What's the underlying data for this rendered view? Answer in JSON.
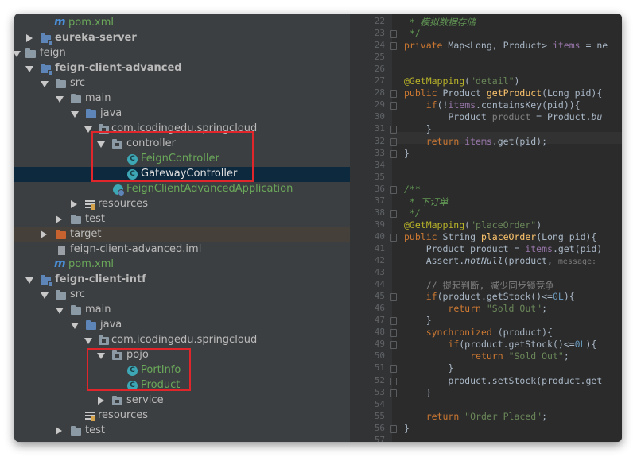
{
  "tree": {
    "rows": [
      {
        "label": "pom.xml"
      },
      {
        "label": "eureka-server"
      },
      {
        "label": "feign"
      },
      {
        "label": "feign-client-advanced"
      },
      {
        "label": "src"
      },
      {
        "label": "main"
      },
      {
        "label": "java"
      },
      {
        "label": "com.icodingedu.springcloud"
      },
      {
        "label": "controller"
      },
      {
        "label": "FeignController"
      },
      {
        "label": "GatewayController"
      },
      {
        "label": "FeignClientAdvancedApplication"
      },
      {
        "label": "resources"
      },
      {
        "label": "test"
      },
      {
        "label": "target"
      },
      {
        "label": "feign-client-advanced.iml"
      },
      {
        "label": "pom.xml"
      },
      {
        "label": "feign-client-intf"
      },
      {
        "label": "src"
      },
      {
        "label": "main"
      },
      {
        "label": "java"
      },
      {
        "label": "com.icodingedu.springcloud"
      },
      {
        "label": "pojo"
      },
      {
        "label": "PortInfo"
      },
      {
        "label": "Product"
      },
      {
        "label": "service"
      },
      {
        "label": "resources"
      },
      {
        "label": "test"
      }
    ]
  },
  "editor": {
    "line_numbers": [
      "22",
      "23",
      "24",
      "25",
      "26",
      "27",
      "28",
      "29",
      "30",
      "31",
      "32",
      "33",
      "34",
      "35",
      "36",
      "37",
      "38",
      "39",
      "40",
      "41",
      "42",
      "43",
      "44",
      "45",
      "46",
      "47",
      "48",
      "49",
      "50",
      "51",
      "52",
      "53",
      "54",
      "55",
      "56",
      "57"
    ],
    "lines": [
      [
        {
          "t": "com",
          "v": " * 模拟数据存储"
        }
      ],
      [
        {
          "t": "com",
          "v": " */"
        }
      ],
      [
        {
          "t": "kw",
          "v": "private "
        },
        {
          "t": "txt",
          "v": "Map<Long, Product> "
        },
        {
          "t": "fld",
          "v": "items"
        },
        {
          "t": "txt",
          "v": " = ne"
        }
      ],
      [],
      [],
      [
        {
          "t": "ann",
          "v": "@GetMapping"
        },
        {
          "t": "txt",
          "v": "("
        },
        {
          "t": "str",
          "v": "\"detail\""
        },
        {
          "t": "txt",
          "v": ")"
        }
      ],
      [
        {
          "t": "kw",
          "v": "public "
        },
        {
          "t": "txt",
          "v": "Product "
        },
        {
          "t": "fn",
          "v": "getProduct"
        },
        {
          "t": "txt",
          "v": "(Long pid){"
        }
      ],
      [
        {
          "t": "txt",
          "v": "    "
        },
        {
          "t": "kw",
          "v": "if"
        },
        {
          "t": "txt",
          "v": "(!"
        },
        {
          "t": "fld",
          "v": "items"
        },
        {
          "t": "txt",
          "v": ".containsKey(pid)){"
        }
      ],
      [
        {
          "t": "txt",
          "v": "        Product "
        },
        {
          "t": "gray",
          "v": "product"
        },
        {
          "t": "txt",
          "v": " = Product."
        },
        {
          "t": "ital",
          "v": "bu"
        }
      ],
      [
        {
          "t": "txt",
          "v": "    }"
        }
      ],
      [
        {
          "t": "txt",
          "v": "    "
        },
        {
          "t": "kw",
          "v": "return "
        },
        {
          "t": "fld",
          "v": "items"
        },
        {
          "t": "txt",
          "v": ".get(pid);"
        }
      ],
      [
        {
          "t": "txt",
          "v": "}"
        }
      ],
      [],
      [],
      [
        {
          "t": "com",
          "v": "/**"
        }
      ],
      [
        {
          "t": "com",
          "v": " * 下订单"
        }
      ],
      [
        {
          "t": "com",
          "v": " */"
        }
      ],
      [
        {
          "t": "ann",
          "v": "@GetMapping"
        },
        {
          "t": "txt",
          "v": "("
        },
        {
          "t": "str",
          "v": "\"placeOrder\""
        },
        {
          "t": "txt",
          "v": ")"
        }
      ],
      [
        {
          "t": "kw",
          "v": "public "
        },
        {
          "t": "txt",
          "v": "String "
        },
        {
          "t": "fn",
          "v": "placeOrder"
        },
        {
          "t": "txt",
          "v": "(Long pid){"
        }
      ],
      [
        {
          "t": "txt",
          "v": "    Product product = "
        },
        {
          "t": "fld",
          "v": "items"
        },
        {
          "t": "txt",
          "v": ".get(pid)"
        }
      ],
      [
        {
          "t": "txt",
          "v": "    Assert."
        },
        {
          "t": "ital",
          "v": "notNull"
        },
        {
          "t": "txt",
          "v": "(product, "
        },
        {
          "t": "hint",
          "v": "message:"
        }
      ],
      [],
      [
        {
          "t": "gray",
          "v": "    // 提起判断, 减少同步锁竞争"
        }
      ],
      [
        {
          "t": "txt",
          "v": "    "
        },
        {
          "t": "kw",
          "v": "if"
        },
        {
          "t": "txt",
          "v": "(product.getStock()<="
        },
        {
          "t": "num",
          "v": "0L"
        },
        {
          "t": "txt",
          "v": "){"
        }
      ],
      [
        {
          "t": "txt",
          "v": "        "
        },
        {
          "t": "kw",
          "v": "return "
        },
        {
          "t": "str",
          "v": "\"Sold Out\""
        },
        {
          "t": "txt",
          "v": ";"
        }
      ],
      [
        {
          "t": "txt",
          "v": "    }"
        }
      ],
      [
        {
          "t": "txt",
          "v": "    "
        },
        {
          "t": "kw",
          "v": "synchronized "
        },
        {
          "t": "txt",
          "v": "(product){"
        }
      ],
      [
        {
          "t": "txt",
          "v": "        "
        },
        {
          "t": "kw",
          "v": "if"
        },
        {
          "t": "txt",
          "v": "(product.getStock()<="
        },
        {
          "t": "num",
          "v": "0L"
        },
        {
          "t": "txt",
          "v": "){"
        }
      ],
      [
        {
          "t": "txt",
          "v": "            "
        },
        {
          "t": "kw",
          "v": "return "
        },
        {
          "t": "str",
          "v": "\"Sold Out\""
        },
        {
          "t": "txt",
          "v": ";"
        }
      ],
      [
        {
          "t": "txt",
          "v": "        }"
        }
      ],
      [
        {
          "t": "txt",
          "v": "        product.setStock(product.get"
        }
      ],
      [
        {
          "t": "txt",
          "v": "    }"
        }
      ],
      [],
      [
        {
          "t": "txt",
          "v": "    "
        },
        {
          "t": "kw",
          "v": "return "
        },
        {
          "t": "str",
          "v": "\"Order Placed\""
        },
        {
          "t": "txt",
          "v": ";"
        }
      ],
      [
        {
          "t": "txt",
          "v": "}"
        }
      ],
      []
    ]
  }
}
